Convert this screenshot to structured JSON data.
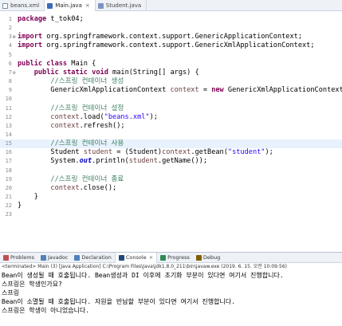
{
  "editor_tabs": [
    {
      "label": "beans.xml",
      "icon": "xml-file-icon"
    },
    {
      "label": "Main.java",
      "icon": "java-file-icon"
    },
    {
      "label": "Student.java",
      "icon": "java-file-icon"
    }
  ],
  "editor": {
    "highlight_line": 15,
    "lines": [
      {
        "num": "1",
        "marker": "",
        "html": "<span class=\"kw\">package</span> t_tok04;"
      },
      {
        "num": "2",
        "marker": "",
        "html": ""
      },
      {
        "num": "3",
        "marker": "⊕",
        "html": "<span class=\"kw\">import</span> org.springframework.context.support.GenericApplicationContext;"
      },
      {
        "num": "4",
        "marker": "",
        "html": "<span class=\"kw\">import</span> org.springframework.context.support.GenericXmlApplicationContext;"
      },
      {
        "num": "5",
        "marker": "",
        "html": ""
      },
      {
        "num": "6",
        "marker": "",
        "html": "<span class=\"kw\">public</span> <span class=\"kw\">class</span> Main {"
      },
      {
        "num": "7",
        "marker": "⊖",
        "html": "    <span class=\"kw\">public</span> <span class=\"kw\">static</span> <span class=\"kw\">void</span> main(String[] args) {"
      },
      {
        "num": "8",
        "marker": "",
        "html": "        <span class=\"cm\">//스프링 컨테이너 생성</span>"
      },
      {
        "num": "9",
        "marker": "",
        "html": "        GenericXmlApplicationContext <span class=\"loc\">context</span> = <span class=\"kw\">new</span> GenericXmlApplicationContext();"
      },
      {
        "num": "10",
        "marker": "",
        "html": ""
      },
      {
        "num": "11",
        "marker": "",
        "html": "        <span class=\"cm\">//스프링 컨테이너 설정</span>"
      },
      {
        "num": "12",
        "marker": "",
        "html": "        <span class=\"loc\">context</span>.load(<span class=\"str\">\"beans.xml\"</span>);"
      },
      {
        "num": "13",
        "marker": "",
        "html": "        <span class=\"loc\">context</span>.refresh();"
      },
      {
        "num": "14",
        "marker": "",
        "html": ""
      },
      {
        "num": "15",
        "marker": "",
        "html": "        <span class=\"cm\">//스프링 컨테이너 사용</span>"
      },
      {
        "num": "16",
        "marker": "",
        "html": "        Student <span class=\"loc\">student</span> = (Student)<span class=\"loc\">context</span>.getBean(<span class=\"str\">\"student\"</span>);"
      },
      {
        "num": "17",
        "marker": "",
        "html": "        System.<span class=\"fld\">out</span>.println(<span class=\"loc\">student</span>.getName());"
      },
      {
        "num": "18",
        "marker": "",
        "html": ""
      },
      {
        "num": "19",
        "marker": "",
        "html": "        <span class=\"cm\">//스프링 컨테이너 종료</span>"
      },
      {
        "num": "20",
        "marker": "",
        "html": "        <span class=\"loc\">context</span>.close();"
      },
      {
        "num": "21",
        "marker": "",
        "html": "    }"
      },
      {
        "num": "22",
        "marker": "",
        "html": "}"
      },
      {
        "num": "23",
        "marker": "",
        "html": ""
      }
    ]
  },
  "panel_tabs": [
    {
      "label": "Problems",
      "icon": "problems-icon",
      "color": "#c0504d",
      "active": false
    },
    {
      "label": "Javadoc",
      "icon": "javadoc-icon",
      "color": "#4f81bd",
      "active": false
    },
    {
      "label": "Declaration",
      "icon": "declaration-icon",
      "color": "#4f81bd",
      "active": false
    },
    {
      "label": "Console",
      "icon": "console-icon",
      "color": "#1f497d",
      "active": true
    },
    {
      "label": "Progress",
      "icon": "progress-icon",
      "color": "#2e8b57",
      "active": false
    },
    {
      "label": "Debug",
      "icon": "debug-icon",
      "color": "#7f6000",
      "active": false
    }
  ],
  "console": {
    "status": "<terminated> Main (3) [Java Application] C:\\Program Files\\Java\\jdk1.8.0_211\\bin\\javaw.exe (2019. 6. 15. 오전 10:09:56)",
    "lines": [
      "Bean이 생성될 때 호출됩니다. Bean생성과 DI 이후에 초기화 부분이 있다면 여기서 진행합니다.",
      "스프링은 학생인가요?",
      "스프링",
      "Bean이 소멸될 때 호출됩니다. 자원을 반납할 부분이 있다면 여기서 진행합니다.",
      "스프링은 학생이 아니었습니다."
    ]
  }
}
